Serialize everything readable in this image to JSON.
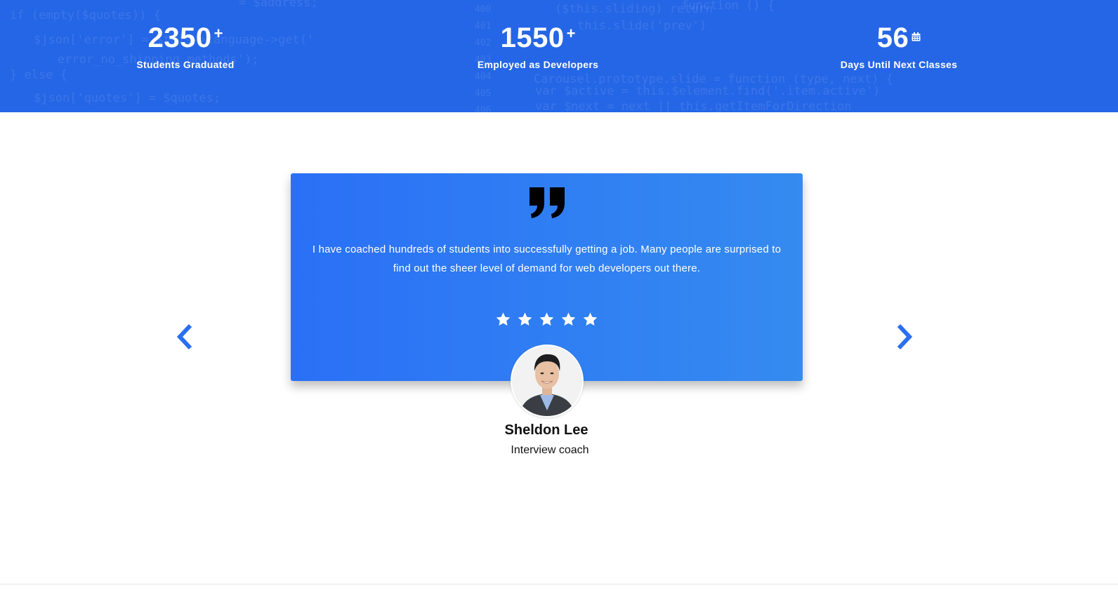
{
  "colors": {
    "banner_bg": "#2566e6",
    "card_gradient_start": "#2a70f6",
    "card_gradient_end": "#358bf0",
    "arrow": "#2a6ff0",
    "text_on_blue": "#ffffff",
    "text_dark": "#111111"
  },
  "stats": [
    {
      "value": "2350",
      "suffix": "+",
      "label": "Students Graduated"
    },
    {
      "value": "1550",
      "suffix": "+",
      "label": "Employed as Developers"
    },
    {
      "value": "56",
      "suffix_icon": "calendar-icon",
      "label": "Days Until Next Classes"
    }
  ],
  "background_code": [
    "if (empty($quotes)) {",
    "$json['error'] = $this->language->get('",
    "error_no_shipping_methods');",
    "} else {",
    "$json['quotes'] = $quotes;",
    "($this.sliding) return",
    "this.slide('prev')",
    "function () {",
    "Carousel.prototype.slide = function (type, next) {",
    "var $active = this.$element.find('.item.active')",
    "var $next = next || this.getItemForDirection",
    "400",
    "401",
    "402",
    "403",
    "404",
    "405",
    "406",
    "= $address;"
  ],
  "testimonial": {
    "quote_icon": "quote-icon",
    "text": "I have coached hundreds of students into successfully getting a job. Many people are surprised to find out the sheer level of demand for web developers out there.",
    "rating": 5,
    "author_name": "Sheldon Lee",
    "author_role": "Interview coach"
  },
  "navigation": {
    "prev_icon": "chevron-left-icon",
    "next_icon": "chevron-right-icon"
  }
}
